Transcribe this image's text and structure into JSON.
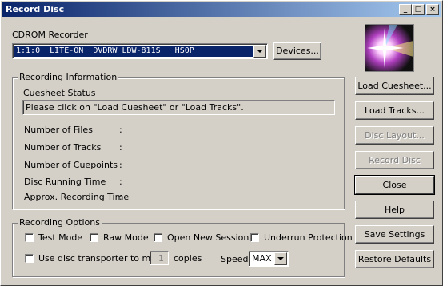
{
  "window": {
    "title": "Record Disc",
    "controls": [
      "_",
      "□",
      "×"
    ]
  },
  "cdrom": {
    "label": "CDROM Recorder",
    "selected": "1:1:0  LITE-ON  DVDRW LDW-811S   HS0P",
    "devices_button": "Devices..."
  },
  "recording_info": {
    "title": "Recording Information",
    "cuesheet_status_label": "Cuesheet Status",
    "cuesheet_status_value": "Please click on \"Load Cuesheet\" or \"Load Tracks\".",
    "rows": [
      {
        "label": "Number of Files",
        "value": ":"
      },
      {
        "label": "Number of Tracks",
        "value": ":"
      },
      {
        "label": "Number of Cuepoints",
        "value": ":"
      },
      {
        "label": "Disc Running Time",
        "value": ":"
      },
      {
        "label": "Approx. Recording Time",
        "value": ":"
      }
    ]
  },
  "options": {
    "title": "Recording Options",
    "test_mode": "Test Mode",
    "raw_mode": "Raw Mode",
    "open_new_session": "Open New Session",
    "underrun_protection": "Underrun Protection",
    "use_transporter": "Use disc transporter to make",
    "copies_value": "1",
    "copies_label": "copies",
    "speed_label": "Speed",
    "speed_value": "MAX"
  },
  "buttons": {
    "load_cuesheet": "Load Cuesheet...",
    "load_tracks": "Load Tracks...",
    "disc_layout": "Disc Layout...",
    "record_disc": "Record Disc",
    "close": "Close",
    "help": "Help",
    "save_settings": "Save Settings",
    "restore_defaults": "Restore Defaults"
  },
  "colors": {
    "titlebar_start": "#0a246a",
    "selection": "#0a246a",
    "face": "#d4d0c8"
  }
}
